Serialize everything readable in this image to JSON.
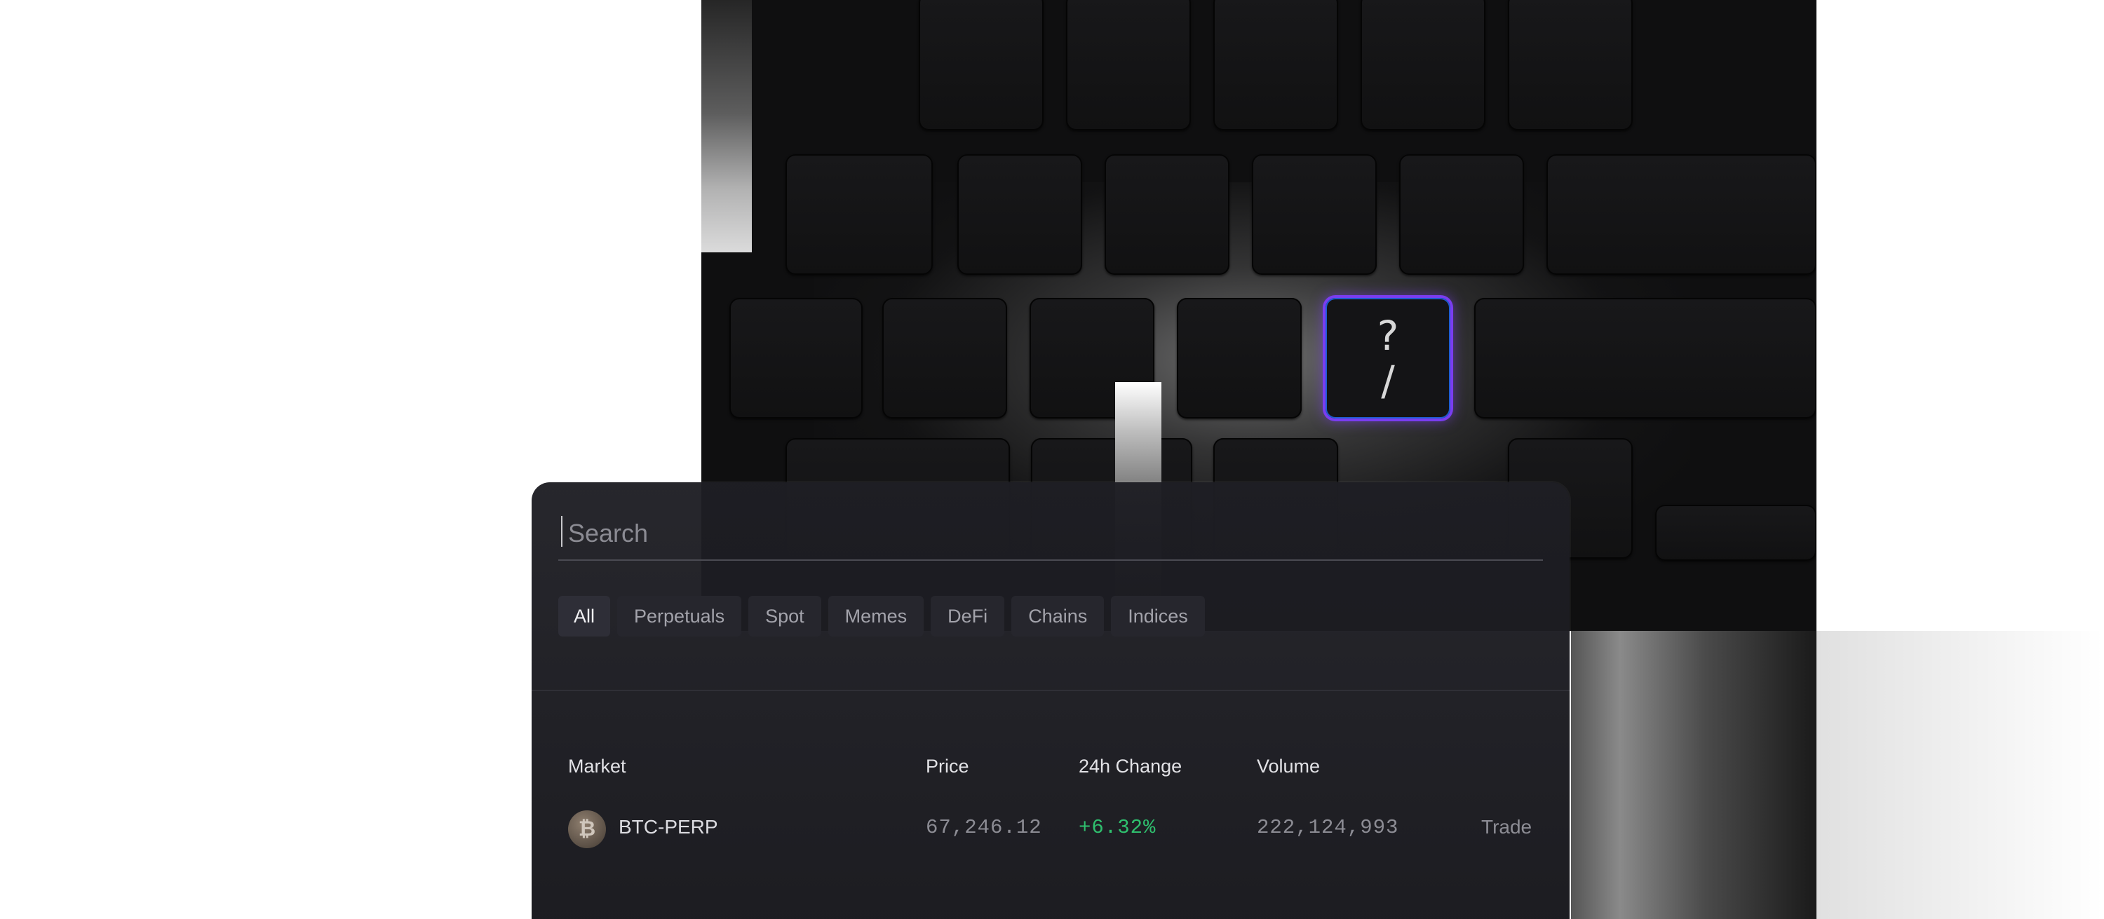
{
  "keyboard": {
    "highlighted_key": {
      "shift_glyph": "?",
      "base_glyph": "/",
      "glow_color": "#7a3df0"
    }
  },
  "search": {
    "placeholder": "Search",
    "value": ""
  },
  "filters": [
    {
      "label": "All",
      "active": true
    },
    {
      "label": "Perpetuals",
      "active": false
    },
    {
      "label": "Spot",
      "active": false
    },
    {
      "label": "Memes",
      "active": false
    },
    {
      "label": "DeFi",
      "active": false
    },
    {
      "label": "Chains",
      "active": false
    },
    {
      "label": "Indices",
      "active": false
    }
  ],
  "table": {
    "headers": {
      "market": "Market",
      "price": "Price",
      "change": "24h Change",
      "volume": "Volume"
    },
    "rows": [
      {
        "icon": "bitcoin-icon",
        "icon_glyph": "₿",
        "market": "BTC-PERP",
        "price": "67,246.12",
        "change": "+6.32%",
        "volume": "222,124,993",
        "action": "Trade"
      }
    ]
  },
  "colors": {
    "positive": "#2fbf6e",
    "accent": "#7a3df0"
  }
}
